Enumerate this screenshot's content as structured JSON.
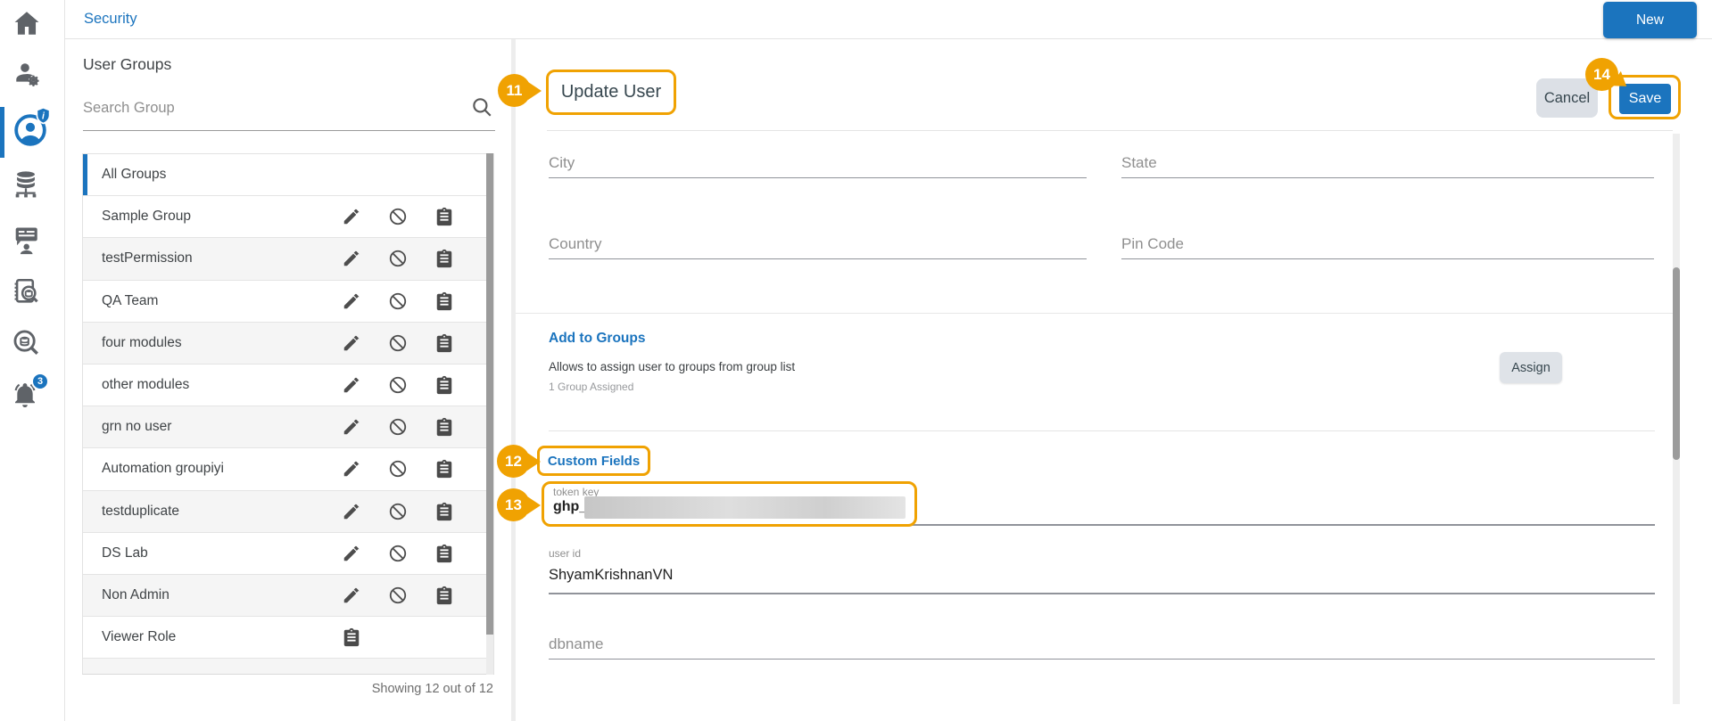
{
  "app": {
    "accent_blue": "#1b74be",
    "annotation_orange": "#f0a202"
  },
  "topbar": {
    "title": "Security",
    "new_button": "New"
  },
  "sidebar": {
    "icons": [
      "home-icon",
      "user-settings-icon",
      "security-icon",
      "database-icon",
      "training-icon",
      "audit-log-icon",
      "data-search-icon",
      "notifications-icon"
    ],
    "active_item": "security",
    "security_badge": "i",
    "notification_count": "3"
  },
  "groups_panel": {
    "title": "User Groups",
    "search_placeholder": "Search Group",
    "footer": "Showing 12 out of 12",
    "groups": [
      {
        "label": "All Groups",
        "active": true,
        "actions": []
      },
      {
        "label": "Sample Group",
        "actions": [
          "edit",
          "disable",
          "permissions"
        ]
      },
      {
        "label": "testPermission",
        "actions": [
          "edit",
          "disable",
          "permissions"
        ]
      },
      {
        "label": "QA Team",
        "actions": [
          "edit",
          "disable",
          "permissions"
        ]
      },
      {
        "label": "four modules",
        "actions": [
          "edit",
          "disable",
          "permissions"
        ]
      },
      {
        "label": "other modules",
        "actions": [
          "edit",
          "disable",
          "permissions"
        ]
      },
      {
        "label": "grn no user",
        "actions": [
          "edit",
          "disable",
          "permissions"
        ]
      },
      {
        "label": "Automation groupiyi",
        "actions": [
          "edit",
          "disable",
          "permissions"
        ]
      },
      {
        "label": "testduplicate",
        "actions": [
          "edit",
          "disable",
          "permissions"
        ]
      },
      {
        "label": "DS Lab",
        "actions": [
          "edit",
          "disable",
          "permissions"
        ]
      },
      {
        "label": "Non Admin",
        "actions": [
          "edit",
          "disable",
          "permissions"
        ]
      },
      {
        "label": "Viewer Role",
        "actions": [
          "permissions"
        ]
      }
    ]
  },
  "main": {
    "title": "Update User",
    "callouts": [
      "11",
      "12",
      "13",
      "14"
    ],
    "cancel_button": "Cancel",
    "save_button": "Save",
    "address_fields": {
      "city": "City",
      "state": "State",
      "country": "Country",
      "pincode": "Pin Code"
    },
    "add_to_groups": {
      "heading": "Add to Groups",
      "description": "Allows to assign user to groups from group list",
      "assigned_count": "1 Group Assigned",
      "assign_button": "Assign"
    },
    "custom_fields": {
      "heading": "Custom Fields",
      "token_label": "token key",
      "token_value": "ghp_",
      "user_id_label": "user id",
      "user_id_value": "ShyamKrishnanVN",
      "dbname_placeholder": "dbname"
    }
  }
}
